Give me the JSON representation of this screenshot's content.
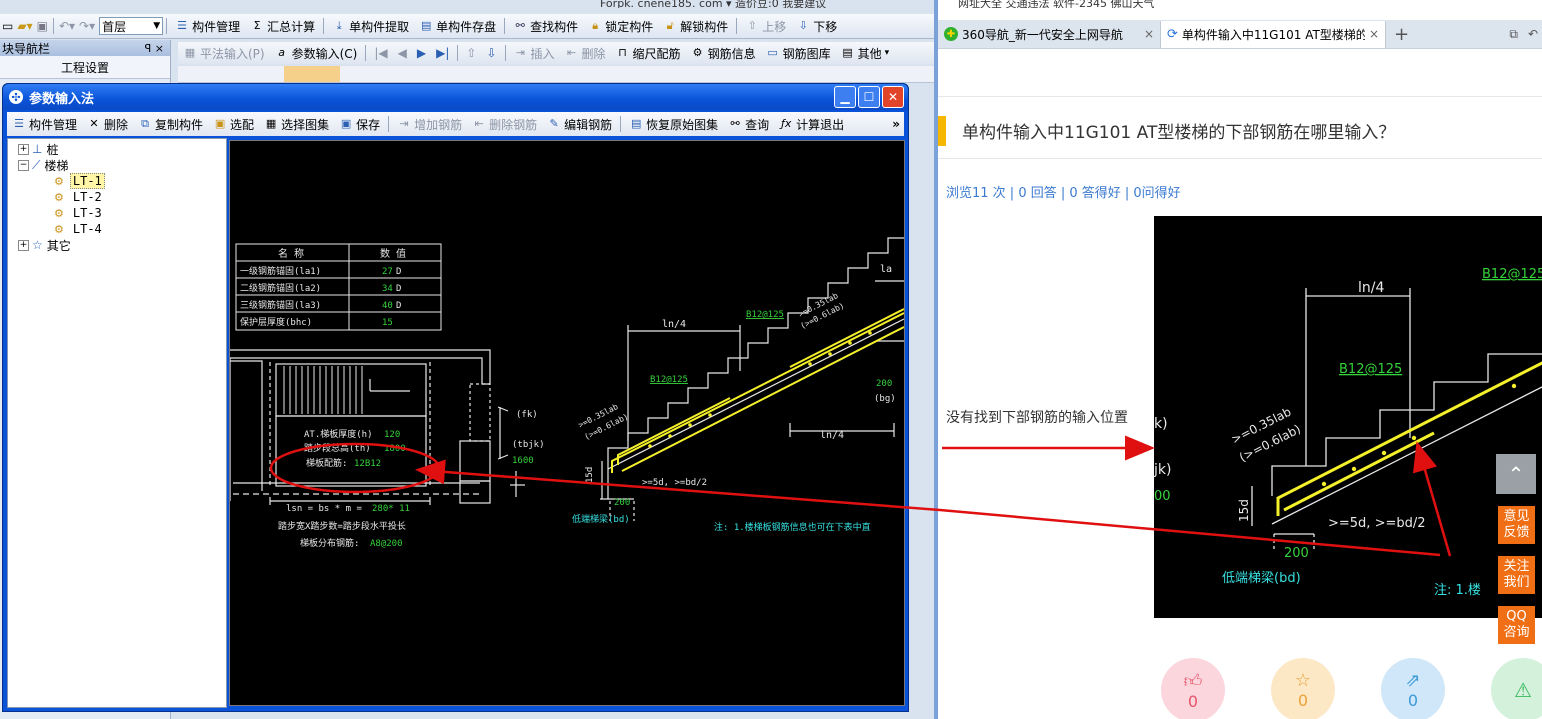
{
  "left_app": {
    "top_strip_text": "Forpk. cnene185. com ▾ 造价豆:0   我要建议",
    "floor_select": "首层",
    "toolbar": [
      {
        "label": "构件管理",
        "icon": "list-icon"
      },
      {
        "label": "汇总计算",
        "icon": "sigma-icon"
      },
      {
        "label": "单构件提取",
        "icon": "extract-icon"
      },
      {
        "label": "单构件存盘",
        "icon": "save-disk-icon"
      },
      {
        "label": "查找构件",
        "icon": "binoculars-icon"
      },
      {
        "label": "锁定构件",
        "icon": "lock-icon"
      },
      {
        "label": "解锁构件",
        "icon": "unlock-icon"
      },
      {
        "label": "上移",
        "icon": "arrow-up-icon"
      },
      {
        "label": "下移",
        "icon": "arrow-down-icon"
      }
    ],
    "navbar": {
      "title": "块导航栏",
      "pin": "ꟼ ×",
      "project_settings": "工程设置"
    },
    "second_toolbar": {
      "flat_input": "平法输入(P)",
      "param_input": "参数输入(C)",
      "insert": "插入",
      "delete": "删除",
      "scale_rebar": "缩尺配筋",
      "rebar_info": "钢筋信息",
      "rebar_library": "钢筋图库",
      "other": "其他"
    },
    "dialog": {
      "title": "参数输入法",
      "toolbar": [
        {
          "label": "构件管理",
          "enabled": true
        },
        {
          "label": "删除",
          "enabled": true
        },
        {
          "label": "复制构件",
          "enabled": true
        },
        {
          "label": "选配",
          "enabled": true
        },
        {
          "label": "选择图集",
          "enabled": true
        },
        {
          "label": "保存",
          "enabled": true
        },
        {
          "label": "增加钢筋",
          "enabled": false
        },
        {
          "label": "删除钢筋",
          "enabled": false
        },
        {
          "label": "编辑钢筋",
          "enabled": true
        },
        {
          "label": "恢复原始图集",
          "enabled": true
        },
        {
          "label": "查询",
          "enabled": true
        },
        {
          "label": "计算退出",
          "enabled": true
        }
      ],
      "more": "»",
      "tree": {
        "pile": "桩",
        "stair": "楼梯",
        "stair_items": [
          "LT-1",
          "LT-2",
          "LT-3",
          "LT-4"
        ],
        "other": "其它"
      }
    },
    "drawing": {
      "table_header": [
        "名 称",
        "数 值"
      ],
      "table_rows": [
        {
          "name": "一级钢筋锚固(la1)",
          "value": "27",
          "unit": "D"
        },
        {
          "name": "二级钢筋锚固(la2)",
          "value": "34",
          "unit": "D"
        },
        {
          "name": "三级钢筋锚固(la3)",
          "value": "40",
          "unit": "D"
        },
        {
          "name": "保护层厚度(bhc)",
          "value": "15",
          "unit": ""
        }
      ],
      "slab_thickness_label": "AT.梯板厚度(h)",
      "slab_thickness_value": "120",
      "step_height_label": "踏步段总高(th)",
      "step_height_value": "1800",
      "slab_rebar_label": "梯板配筋:",
      "slab_rebar_value": "12B12",
      "lsn_formula_prefix": "lsn = bs * m =",
      "lsn_values": "280* 11",
      "step_width_note": "踏步宽X踏步数=踏步段水平投长",
      "distribution_label": "梯板分布钢筋:",
      "distribution_value": "A8@200",
      "ln4_top": "ln/4",
      "ln4_bottom": "ln/4",
      "rebar_top": "B12@125",
      "rebar_mid": "B12@125",
      "anchor_top": ">=0.35lab",
      "anchor_top2": "(>=0.6lab)",
      "anchor_low": ">=0.35lab",
      "anchor_low2": "(>=0.6lab)",
      "la_label": "la",
      "fk_label": "(fk)",
      "tbjk_label": "(tbjk)",
      "tbjk_value": "1600",
      "bg_value": "200",
      "bg_label": "(bg)",
      "low_beam_value": "200",
      "low_beam_label": "低端梯梁(bd)",
      "d15_label": "15d",
      "anchor_rule": ">=5d, >=bd/2",
      "note": "注: 1.楼梯板钢筋信息也可在下表中直"
    }
  },
  "browser": {
    "top_strip": "网址大全   交通违法   软件-2345   佛山天气",
    "tabs": [
      {
        "title": "360导航_新一代安全上网导航",
        "active": false
      },
      {
        "title": "单构件输入中11G101 AT型楼梯的",
        "active": true
      }
    ],
    "new_tab": "+",
    "question_title": "单构件输入中11G101 AT型楼梯的下部钢筋在哪里输入？",
    "stats": "浏览11 次 | 0 回答 | 0 答得好 | 0问得好",
    "body_text": "没有找到下部钢筋的输入位置",
    "zoom": {
      "ln4": "ln/4",
      "rebar_top": "B12@125",
      "rebar_mid": "B12@125",
      "anchor1": ">=0.35lab",
      "anchor2": "(>=0.6lab)",
      "d15": "15d",
      "rule": ">=5d, >=bd/2",
      "beam_value": "200",
      "beam_label": "低端梯梁(bd)",
      "note": "注: 1.楼",
      "partial_k": "k)",
      "partial_jk": "jk)",
      "partial_00": "00"
    },
    "side_buttons": [
      "意见\n反馈",
      "关注\n我们",
      "QQ\n咨询"
    ],
    "actions": [
      {
        "icon": "thumbs-up-icon",
        "count": "0",
        "bg": "#fbd6dc",
        "fg": "#e8546b"
      },
      {
        "icon": "star-icon",
        "count": "0",
        "bg": "#fde8c6",
        "fg": "#e8a23a"
      },
      {
        "icon": "share-icon",
        "count": "0",
        "bg": "#cfe7f8",
        "fg": "#3b9ad8"
      },
      {
        "icon": "warning-icon",
        "count": "",
        "bg": "#d4f1dc",
        "fg": "#39b85e"
      }
    ]
  },
  "colors": {
    "arrow": "#e01010",
    "cad_yellow": "#f4f02a",
    "cad_green": "#35d33b",
    "cad_cyan": "#37e0e0",
    "cad_white": "#e8e8e8",
    "side_orange": "#f06f14"
  }
}
